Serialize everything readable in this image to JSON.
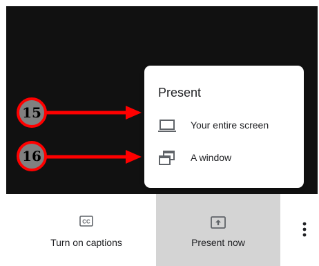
{
  "popup": {
    "title": "Present",
    "items": [
      {
        "label": "Your entire screen",
        "icon": "laptop-icon"
      },
      {
        "label": "A window",
        "icon": "window-icon"
      }
    ]
  },
  "bottom_bar": {
    "captions_label": "Turn on captions",
    "captions_icon_text": "CC",
    "present_label": "Present now"
  },
  "annotations": [
    {
      "number": "15",
      "target": "Your entire screen"
    },
    {
      "number": "16",
      "target": "A window"
    }
  ],
  "colors": {
    "stage_bg": "#111111",
    "annotation_red": "#ff0000",
    "annotation_badge": "#808080",
    "present_bg": "#d4d4d4"
  }
}
